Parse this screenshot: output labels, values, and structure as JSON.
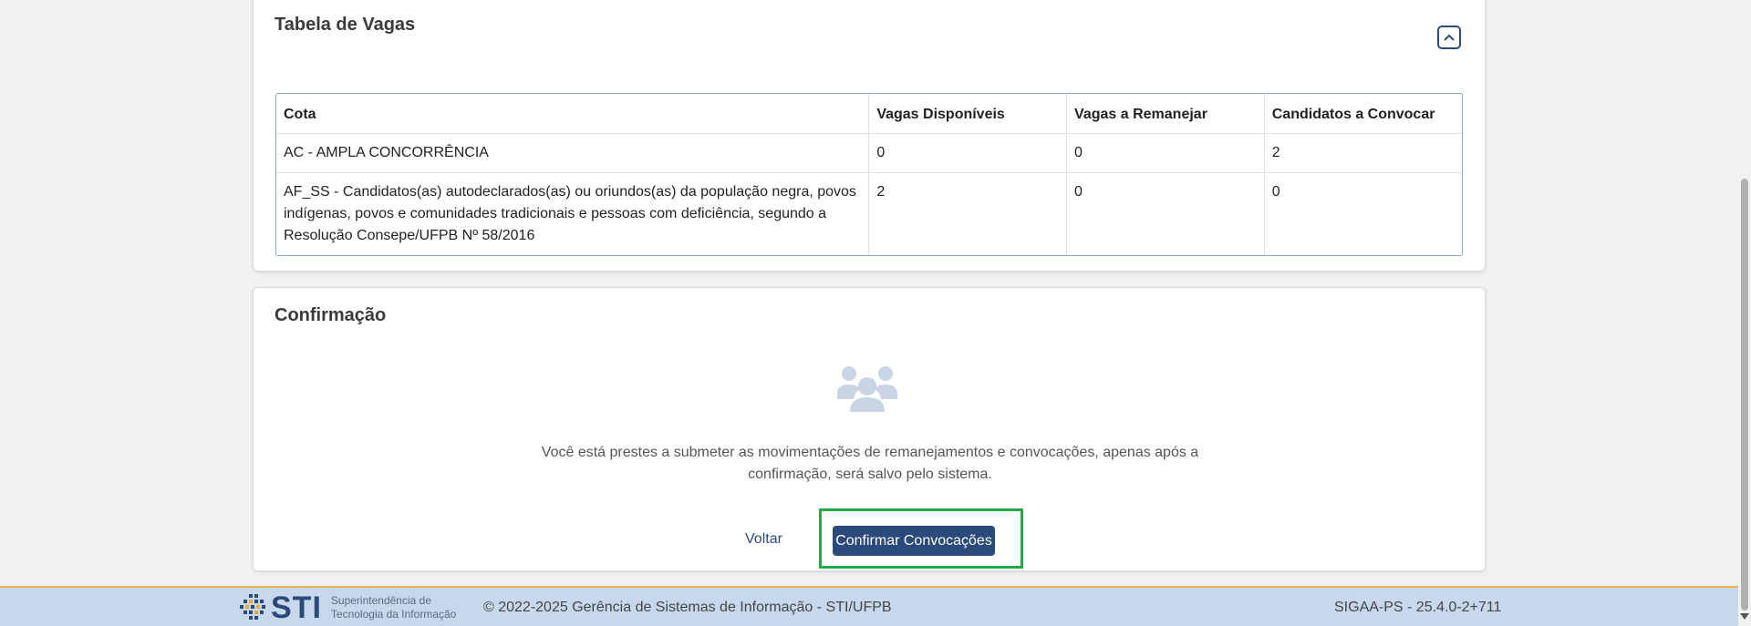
{
  "vagas": {
    "title": "Tabela de Vagas",
    "collapse_icon": "chevron-up-icon",
    "headers": [
      "Cota",
      "Vagas Disponíveis",
      "Vagas a Remanejar",
      "Candidatos a Convocar"
    ],
    "rows": [
      [
        "AC - AMPLA CONCORRÊNCIA",
        "0",
        "0",
        "2"
      ],
      [
        "AF_SS - Candidatos(as) autodeclarados(as) ou oriundos(as) da população negra, povos indígenas, povos e comunidades tradicionais e pessoas com deficiência, segundo a Resolução Consepe/UFPB Nº 58/2016",
        "2",
        "0",
        "0"
      ]
    ]
  },
  "confirmacao": {
    "title": "Confirmação",
    "icon": "users-icon",
    "message": "Você está prestes a submeter as movimentações de remanejamentos e convocações, apenas após a confirmação, será salvo pelo sistema.",
    "back_label": "Voltar",
    "confirm_label": "Confirmar Convocações"
  },
  "footer": {
    "logo_text": "STI",
    "logo_subtitle_line1": "Superintendência de",
    "logo_subtitle_line2": "Tecnologia da Informação",
    "copyright": "© 2022-2025 Gerência de Sistemas de Informação - STI/UFPB",
    "version": "SIGAA-PS - 25.4.0-2+711"
  },
  "colors": {
    "primary": "#2b4a7a",
    "highlight": "#22a94a",
    "footer_bg": "#c8d8ec"
  }
}
